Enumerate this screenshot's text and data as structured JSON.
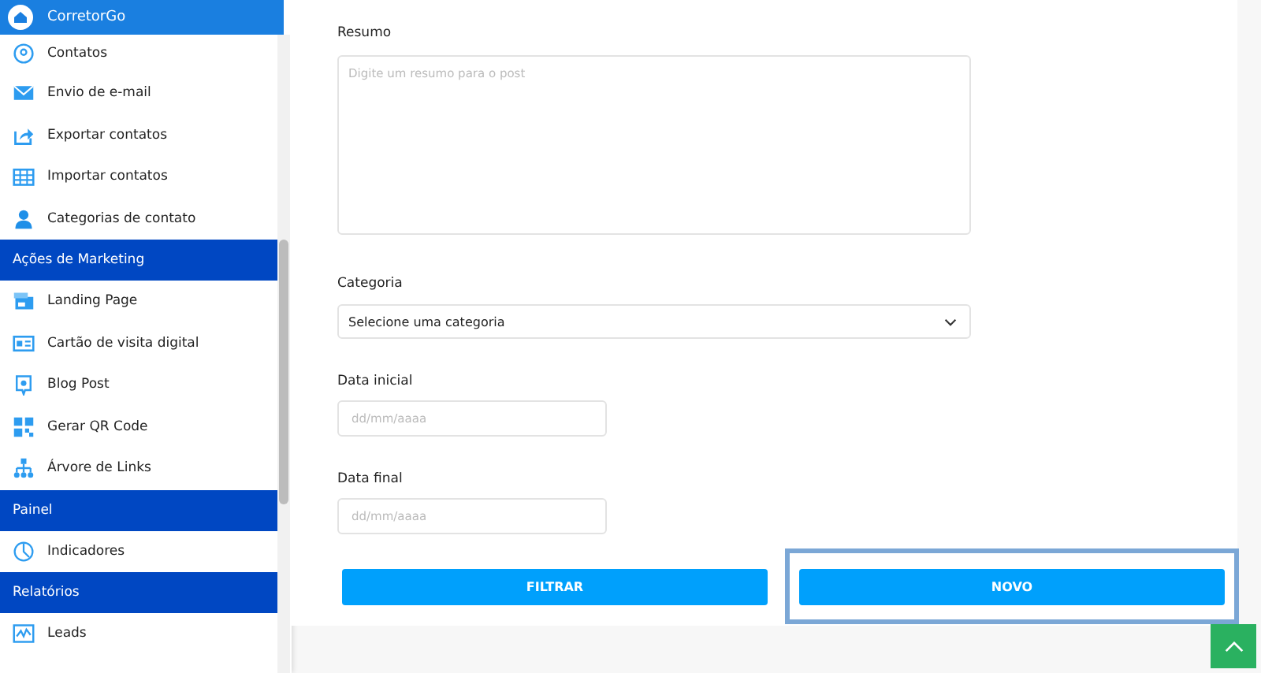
{
  "sidebar": {
    "brand": "CorretorGo",
    "items": [
      {
        "kind": "link",
        "label": "Contatos"
      },
      {
        "kind": "link",
        "label": "Envio de e-mail"
      },
      {
        "kind": "link",
        "label": "Exportar contatos"
      },
      {
        "kind": "link",
        "label": "Importar contatos"
      },
      {
        "kind": "link",
        "label": "Categorias de contato"
      },
      {
        "kind": "section",
        "label": "Ações de Marketing"
      },
      {
        "kind": "link",
        "label": "Landing Page"
      },
      {
        "kind": "link",
        "label": "Cartão de visita digital"
      },
      {
        "kind": "link",
        "label": "Blog Post"
      },
      {
        "kind": "link",
        "label": "Gerar QR Code"
      },
      {
        "kind": "link",
        "label": "Árvore de Links"
      },
      {
        "kind": "section",
        "label": "Painel"
      },
      {
        "kind": "link",
        "label": "Indicadores"
      },
      {
        "kind": "section",
        "label": "Relatórios"
      },
      {
        "kind": "link",
        "label": "Leads"
      }
    ]
  },
  "form": {
    "summary": {
      "label": "Resumo",
      "placeholder": "Digite um resumo para o post"
    },
    "category": {
      "label": "Categoria",
      "value": "Selecione uma categoria"
    },
    "start_date": {
      "label": "Data inicial",
      "placeholder": "dd/mm/aaaa"
    },
    "end_date": {
      "label": "Data final",
      "placeholder": "dd/mm/aaaa"
    },
    "buttons": [
      {
        "label": "FILTRAR",
        "focused": false
      },
      {
        "label": "NOVO",
        "focused": true
      }
    ]
  }
}
